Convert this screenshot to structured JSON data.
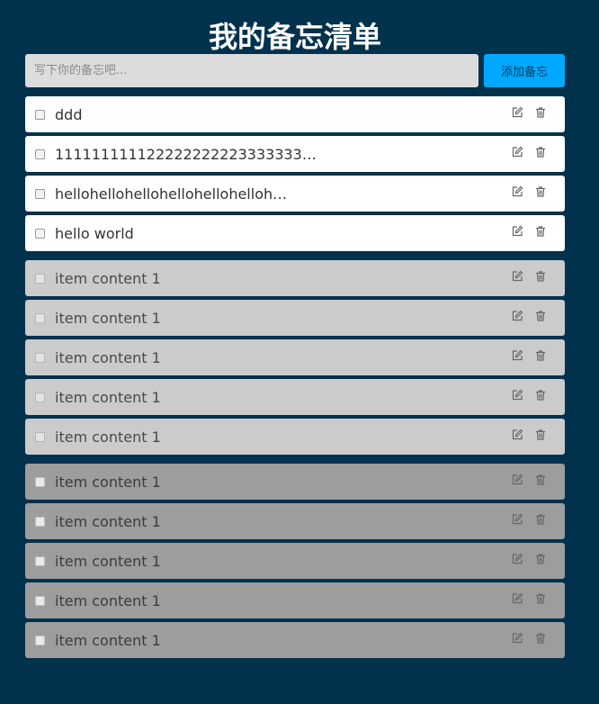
{
  "header": {
    "title": "我的备忘清单"
  },
  "input": {
    "placeholder": "写下你的备忘吧...",
    "value": ""
  },
  "add_button": {
    "label": "添加备忘"
  },
  "icons": {
    "edit": "edit-icon",
    "delete": "trash-icon"
  },
  "colors": {
    "background": "#00324d",
    "add_button": "#00a8ff",
    "active_item": "#ffffff",
    "done_item": "#cbcbcb",
    "archived_item": "#9d9d9d"
  },
  "groups": {
    "active": [
      {
        "text": "ddd",
        "checked": false
      },
      {
        "text": "111111111122222222223333333333…",
        "checked": false
      },
      {
        "text": "hellohellohellohellohellohelloh…",
        "checked": false
      },
      {
        "text": "hello world",
        "checked": false
      }
    ],
    "done": [
      {
        "text": "item content 1",
        "checked": false
      },
      {
        "text": "item content 1",
        "checked": false
      },
      {
        "text": "item content 1",
        "checked": false
      },
      {
        "text": "item content 1",
        "checked": false
      },
      {
        "text": "item content 1",
        "checked": false
      }
    ],
    "archived": [
      {
        "text": "item content 1",
        "checked": false
      },
      {
        "text": "item content 1",
        "checked": false
      },
      {
        "text": "item content 1",
        "checked": false
      },
      {
        "text": "item content 1",
        "checked": false
      },
      {
        "text": "item content 1",
        "checked": false
      }
    ]
  }
}
